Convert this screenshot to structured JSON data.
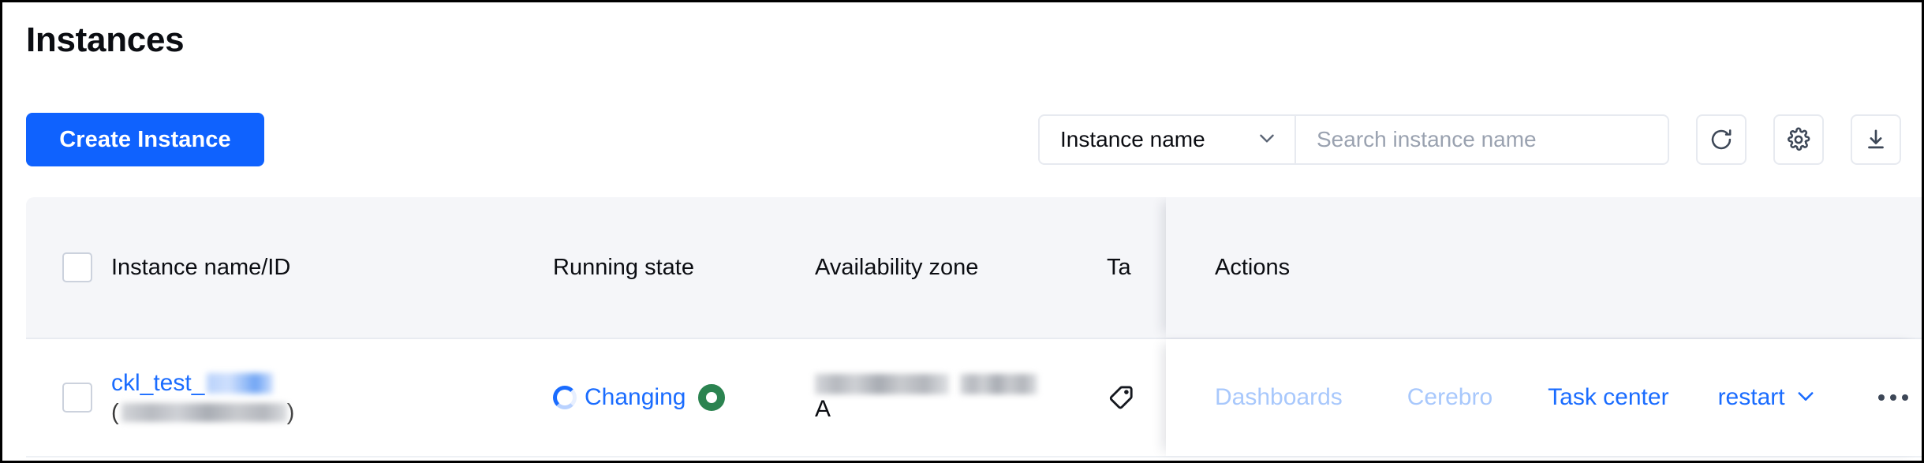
{
  "page": {
    "title": "Instances"
  },
  "toolbar": {
    "create_label": "Create Instance",
    "filter_select": {
      "value": "Instance name",
      "icon": "chevron-down-icon"
    },
    "search": {
      "value": "",
      "placeholder": "Search instance name"
    },
    "buttons": [
      {
        "name": "refresh-button",
        "icon": "refresh-icon",
        "title": "Refresh"
      },
      {
        "name": "settings-button",
        "icon": "gear-icon",
        "title": "Settings"
      },
      {
        "name": "export-button",
        "icon": "download-icon",
        "title": "Export"
      }
    ]
  },
  "table": {
    "columns": [
      {
        "key": "select",
        "label": ""
      },
      {
        "key": "name",
        "label": "Instance name/ID"
      },
      {
        "key": "state",
        "label": "Running state"
      },
      {
        "key": "zone",
        "label": "Availability zone"
      },
      {
        "key": "tags",
        "label": "Ta"
      },
      {
        "key": "actions",
        "label": "Actions"
      }
    ],
    "rows": [
      {
        "selected": false,
        "name_prefix": "ckl_test_",
        "name_redacted": true,
        "id_open": "(",
        "id_redacted": true,
        "id_close": ")",
        "state_text": "Changing",
        "state_spinner_color": "#1a6cff",
        "state_badge_color": "#2b8350",
        "zone_redacted": true,
        "zone_suffix": "A",
        "tag_icon": "tag-icon",
        "actions": [
          {
            "label": "Dashboards",
            "enabled": false,
            "type": "link"
          },
          {
            "label": "Cerebro",
            "enabled": false,
            "type": "link"
          },
          {
            "label": "Task center",
            "enabled": true,
            "type": "link"
          },
          {
            "label": "restart",
            "enabled": true,
            "type": "dropdown",
            "icon": "chevron-down-icon"
          },
          {
            "label": "",
            "enabled": true,
            "type": "more",
            "icon": "ellipsis-icon"
          }
        ]
      }
    ]
  },
  "colors": {
    "primary": "#0f62fe",
    "link": "#1a6cff",
    "link_disabled": "#a8c8fc",
    "header_bg": "#f5f6f9",
    "border": "#e7eaf0",
    "status_green": "#2b8350",
    "icon_dark": "#3d4757",
    "text": "#0b0d12",
    "placeholder": "#9aa2b0"
  }
}
